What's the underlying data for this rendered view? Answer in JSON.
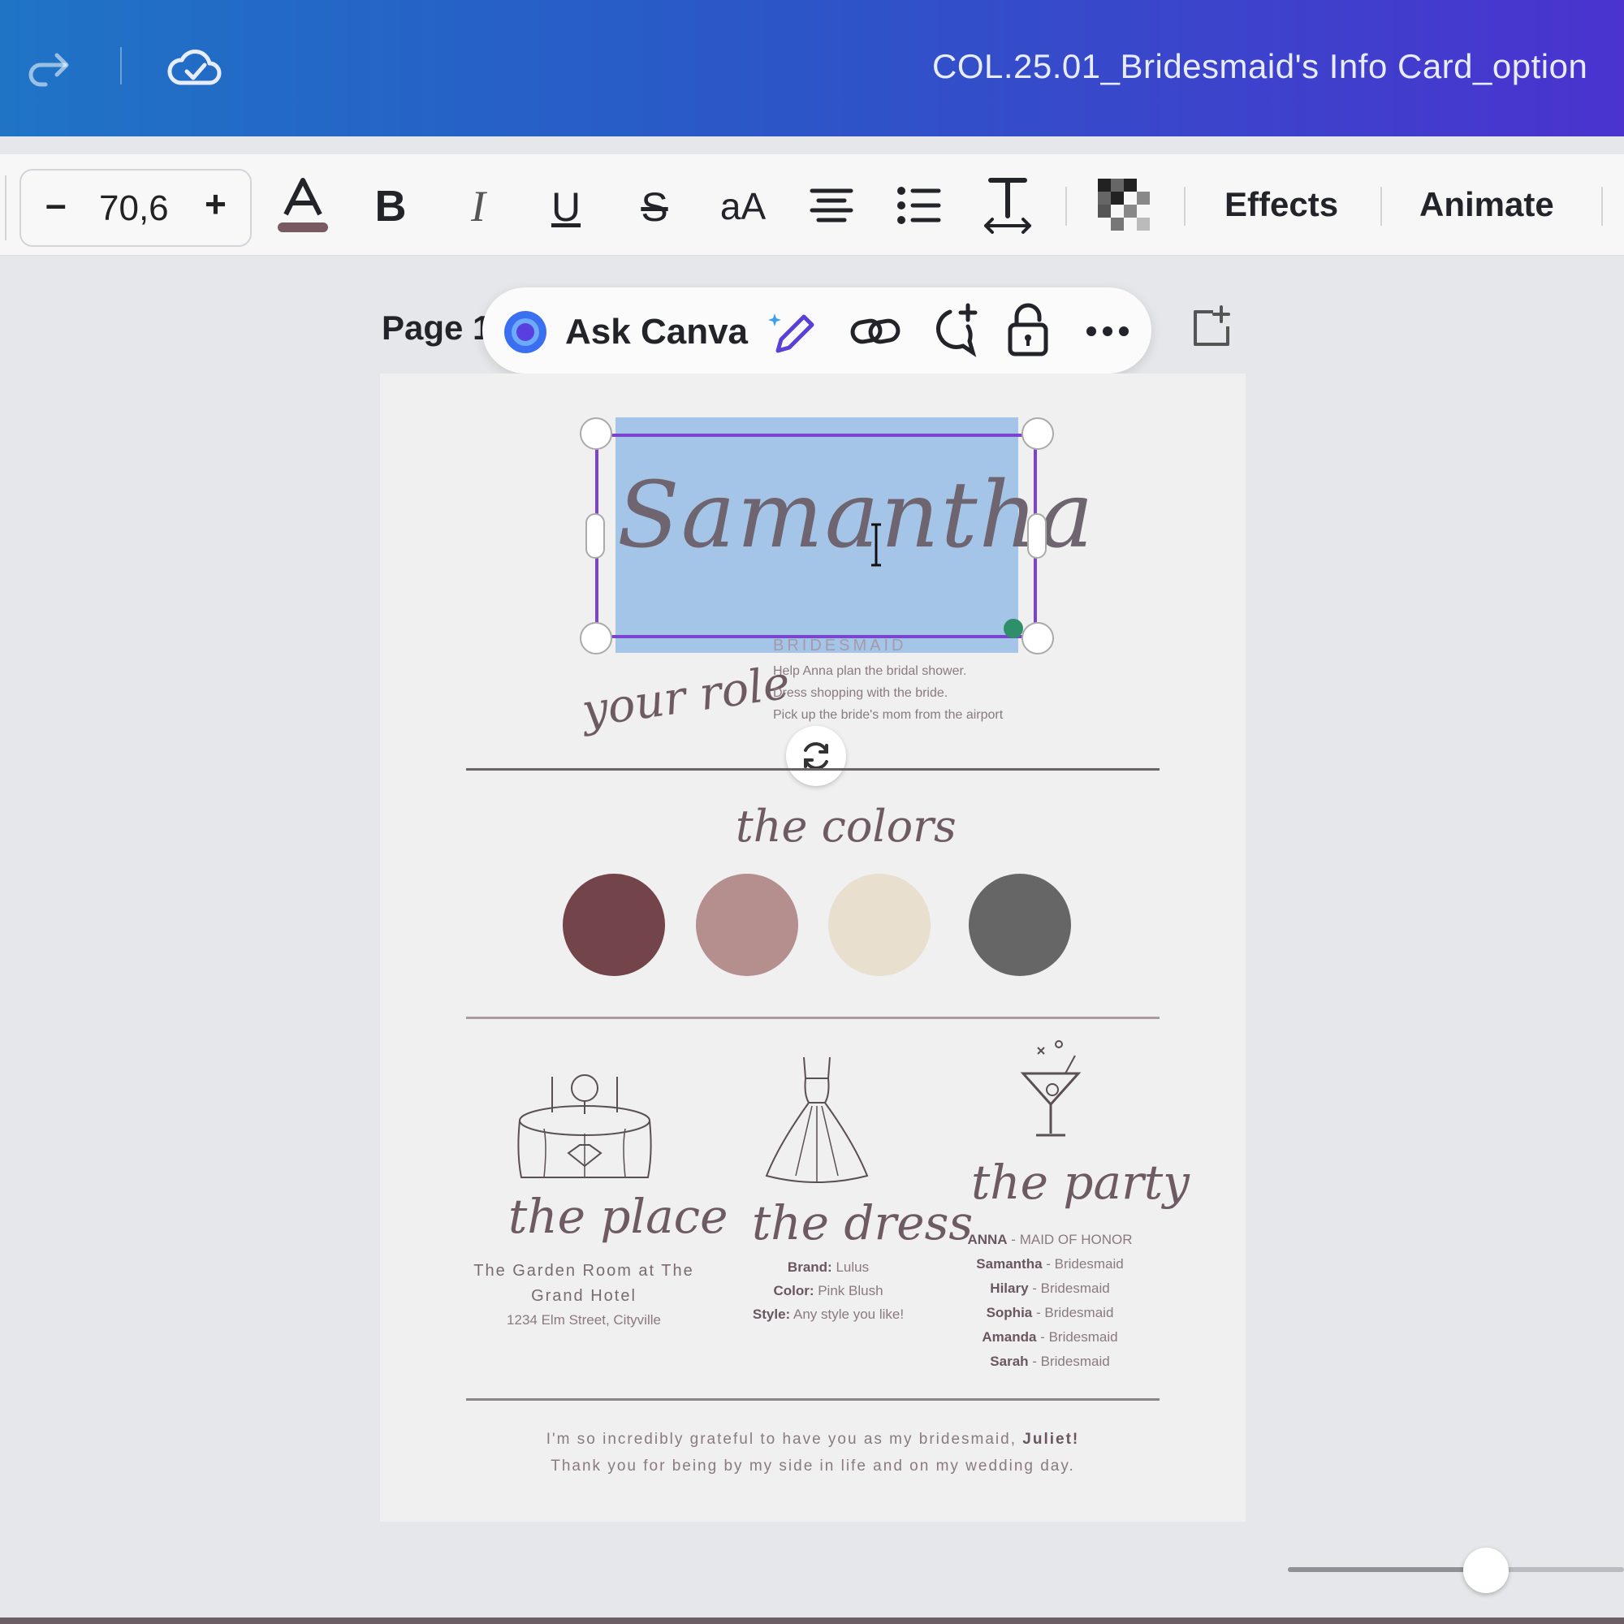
{
  "topbar": {
    "document_title": "COL.25.01_Bridesmaid's Info Card_option"
  },
  "toolbar": {
    "font_size": "70,6",
    "minus": "–",
    "plus": "+",
    "text_color": "#7a5a62",
    "effects_label": "Effects",
    "animate_label": "Animate"
  },
  "floating_toolbar": {
    "page_label": "Page 1",
    "ask_canva_label": "Ask Canva"
  },
  "card": {
    "name": "Samantha",
    "role_heading": "BRIDESMAID",
    "your_role_script": "your role",
    "role_tasks": [
      "Help Anna plan the bridal shower.",
      "Dress shopping with the bride.",
      "Pick up the bride's mom from the airport"
    ],
    "colors_script": "the colors",
    "colors": [
      "#73444a",
      "#b58e8e",
      "#e8dfcf",
      "#666666"
    ],
    "place": {
      "script": "the place",
      "venue": "The Garden Room at The Grand Hotel",
      "address": "1234 Elm Street, Cityville"
    },
    "dress": {
      "script": "the dress",
      "brand_label": "Brand:",
      "brand": "Lulus",
      "color_label": "Color:",
      "color": "Pink Blush",
      "style_label": "Style:",
      "style": "Any style you like!"
    },
    "party": {
      "script": "the party",
      "members": [
        {
          "name": "ANNA",
          "role": "MAID OF HONOR"
        },
        {
          "name": "Samantha",
          "role": "Bridesmaid"
        },
        {
          "name": "Hilary",
          "role": "Bridesmaid"
        },
        {
          "name": "Sophia",
          "role": "Bridesmaid"
        },
        {
          "name": "Amanda",
          "role": "Bridesmaid"
        },
        {
          "name": "Sarah",
          "role": "Bridesmaid"
        }
      ]
    },
    "thanks_line1_pre": "I'm so incredibly grateful to have you as my bridesmaid,",
    "thanks_name": "Juliet!",
    "thanks_line2": "Thank you for being by my side in life and on my wedding day."
  },
  "zoom": {
    "level": 0.59
  }
}
